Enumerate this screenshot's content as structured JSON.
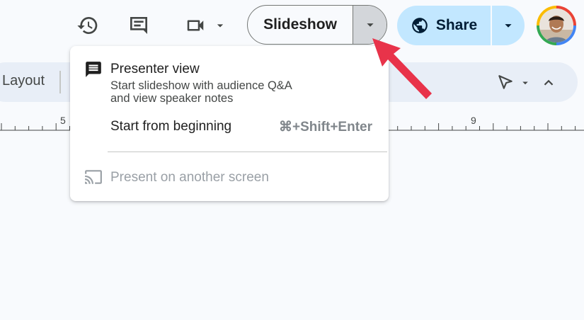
{
  "header": {
    "icons": [
      "version-history-icon",
      "comments-icon",
      "meet-video-icon"
    ],
    "slideshow_label": "Slideshow",
    "share_label": "Share",
    "colors": {
      "share_bg": "#c2e7ff",
      "avatar_ring": [
        "#ea4335",
        "#4285f4",
        "#34a853",
        "#fbbc04"
      ],
      "arrow": "#e8334a"
    }
  },
  "toolbar": {
    "layout_label": "Layout"
  },
  "ruler": {
    "labels": [
      "5",
      "9"
    ]
  },
  "menu": {
    "presenter": {
      "title": "Presenter view",
      "desc_line1": "Start slideshow with audience Q&A",
      "desc_line2": "and view speaker notes"
    },
    "beginning": {
      "title": "Start from beginning",
      "shortcut": "⌘+Shift+Enter"
    },
    "another_screen": {
      "title": "Present on another screen"
    }
  }
}
